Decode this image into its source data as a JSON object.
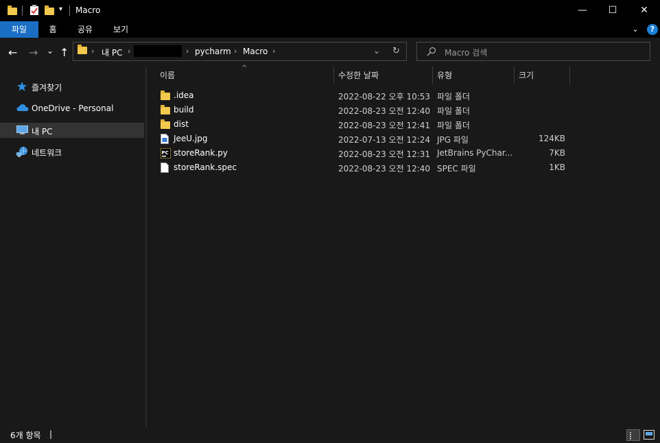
{
  "window": {
    "title": "Macro",
    "controls": {
      "minimize": "—",
      "maximize": "☐",
      "close": "✕"
    }
  },
  "ribbon": {
    "tabs": [
      "파일",
      "홈",
      "공유",
      "보기"
    ],
    "help": "?"
  },
  "nav": {
    "back": "←",
    "forward": "→",
    "recent": "⌄",
    "up": "↑",
    "breadcrumb": [
      "내 PC",
      "pycharm",
      "Macro"
    ],
    "refresh": "↻",
    "search_placeholder": "Macro 검색"
  },
  "sidebar": {
    "items": [
      {
        "label": "즐겨찾기",
        "icon": "star-icon"
      },
      {
        "label": "OneDrive - Personal",
        "icon": "cloud-icon"
      },
      {
        "label": "내 PC",
        "icon": "computer-icon",
        "selected": true
      },
      {
        "label": "네트워크",
        "icon": "network-icon"
      }
    ]
  },
  "columns": [
    "이름",
    "수정한 날짜",
    "유형",
    "크기"
  ],
  "files": [
    {
      "name": ".idea",
      "date": "2022-08-22 오후 10:53",
      "type": "파일 폴더",
      "size": "",
      "icon": "folder-icon"
    },
    {
      "name": "build",
      "date": "2022-08-23 오전 12:40",
      "type": "파일 폴더",
      "size": "",
      "icon": "folder-icon"
    },
    {
      "name": "dist",
      "date": "2022-08-23 오전 12:41",
      "type": "파일 폴더",
      "size": "",
      "icon": "folder-icon"
    },
    {
      "name": "JeeU.jpg",
      "date": "2022-07-13 오전 12:24",
      "type": "JPG 파일",
      "size": "124KB",
      "icon": "image-file-icon"
    },
    {
      "name": "storeRank.py",
      "date": "2022-08-23 오전 12:31",
      "type": "JetBrains PyChar...",
      "size": "7KB",
      "icon": "pycharm-file-icon"
    },
    {
      "name": "storeRank.spec",
      "date": "2022-08-23 오전 12:40",
      "type": "SPEC 파일",
      "size": "1KB",
      "icon": "document-icon"
    }
  ],
  "status": {
    "item_count": "6개 항목"
  },
  "colors": {
    "accent": "#1a6fc4",
    "folder": "#f3c94d",
    "background": "#191919"
  }
}
